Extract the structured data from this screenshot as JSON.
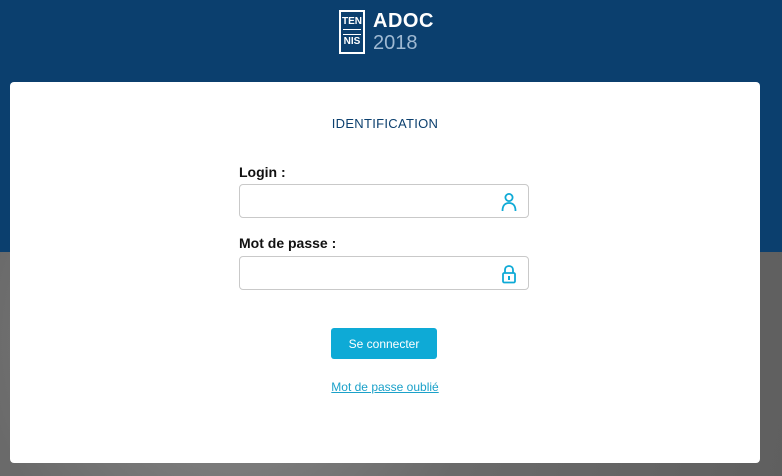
{
  "brand": {
    "logo_line1": "TEN",
    "logo_line2": "NIS",
    "name": "ADOC",
    "year": "2018"
  },
  "form": {
    "title": "IDENTIFICATION",
    "login_label": "Login :",
    "login_value": "",
    "password_label": "Mot de passe :",
    "password_value": "",
    "submit_label": "Se connecter",
    "forgot_link": "Mot de passe oublié"
  },
  "icons": {
    "login": "user-icon",
    "password": "lock-icon"
  },
  "colors": {
    "header_bg": "#0b3f6e",
    "accent": "#0eaad6",
    "link": "#1ba1c9"
  }
}
